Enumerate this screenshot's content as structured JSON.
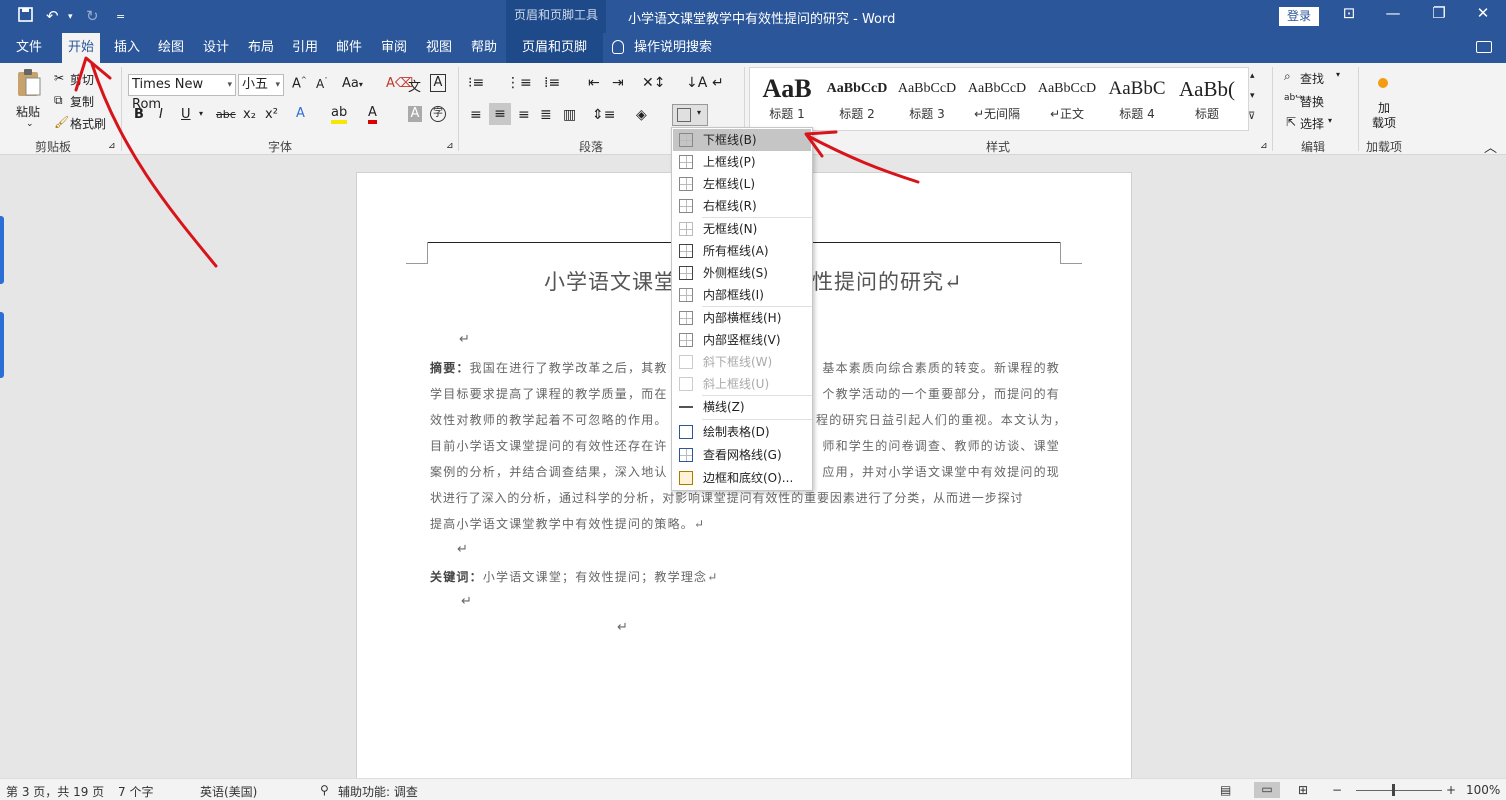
{
  "titlebar": {
    "context_tools": "页眉和页脚工具",
    "doc_title": "小学语文课堂教学中有效性提问的研究 - Word",
    "login": "登录",
    "quick_access_more": "="
  },
  "tabs": [
    {
      "label": "文件"
    },
    {
      "label": "开始"
    },
    {
      "label": "插入"
    },
    {
      "label": "绘图"
    },
    {
      "label": "设计"
    },
    {
      "label": "布局"
    },
    {
      "label": "引用"
    },
    {
      "label": "邮件"
    },
    {
      "label": "审阅"
    },
    {
      "label": "视图"
    },
    {
      "label": "帮助"
    },
    {
      "label": "页眉和页脚"
    }
  ],
  "tell_me": "操作说明搜索",
  "clipboard": {
    "paste": "粘贴",
    "cut": "剪切",
    "copy": "复制",
    "format_painter": "格式刷",
    "group": "剪贴板"
  },
  "font": {
    "name": "Times New Rom",
    "size": "小五",
    "group": "字体",
    "case": "Aa",
    "bold": "B",
    "italic": "I",
    "underline": "U",
    "strike": "abc",
    "subscript": "x₂",
    "superscript": "x²",
    "font_color": "A",
    "char_shading": "A"
  },
  "paragraph": {
    "group": "段落"
  },
  "styles": {
    "group": "样式",
    "items": [
      {
        "sample": "AaB",
        "name": "标题 1"
      },
      {
        "sample": "AaBbCcD",
        "name": "标题 2"
      },
      {
        "sample": "AaBbCcD",
        "name": "标题 3"
      },
      {
        "sample": "AaBbCcD",
        "name": "↵无间隔"
      },
      {
        "sample": "AaBbCcD",
        "name": "↵正文"
      },
      {
        "sample": "AaBbC",
        "name": "标题 4"
      },
      {
        "sample": "AaBb(",
        "name": "标题"
      }
    ]
  },
  "editing": {
    "find": "查找",
    "replace": "替换",
    "select": "选择",
    "group": "编辑"
  },
  "addins": {
    "label": "加\n载项",
    "group": "加载项"
  },
  "border_menu": {
    "items": [
      {
        "label": "下框线(B)",
        "state": "highlighted"
      },
      {
        "label": "上框线(P)"
      },
      {
        "label": "左框线(L)"
      },
      {
        "label": "右框线(R)"
      },
      {
        "label": "无框线(N)"
      },
      {
        "label": "所有框线(A)"
      },
      {
        "label": "外侧框线(S)"
      },
      {
        "label": "内部框线(I)"
      },
      {
        "label": "内部横框线(H)"
      },
      {
        "label": "内部竖框线(V)"
      },
      {
        "label": "斜下框线(W)",
        "state": "disabled"
      },
      {
        "label": "斜上框线(U)",
        "state": "disabled"
      },
      {
        "label": "横线(Z)"
      },
      {
        "label": "绘制表格(D)"
      },
      {
        "label": "查看网格线(G)"
      },
      {
        "label": "边框和底纹(O)..."
      }
    ]
  },
  "document": {
    "heading_left": "小学语文课堂",
    "heading_right": "性提问的研究↵",
    "abstract_label": "摘要：",
    "abstract_lines": [
      "我国在进行了教学改革之后，其教",
      "学目标要求提高了课程的教学质量，而在",
      "效性对教师的教学起着不可忽略的作用。",
      "目前小学语文课堂提问的有效性还存在许",
      "案例的分析，并结合调查结果，深入地认",
      "状进行了深入的分析，通过科学的分析，对影响课堂提问有效性的重要因素进行了分类，从而进一步探讨",
      "提高小学语文课堂教学中有效性提问的策略。↵"
    ],
    "abstract_right": [
      "基本素质向综合素质的转变。新课程的教",
      "个教学活动的一个重要部分，而提问的有",
      "程的研究日益引起人们的重视。本文认为，",
      "师和学生的问卷调查、教师的访谈、课堂",
      "应用，并对小学语文课堂中有效提问的现"
    ],
    "keywords_label": "关键词：",
    "keywords": "小学语文课堂；有效性提问；教学理念↵",
    "pilcrow": "↵"
  },
  "status": {
    "page": "第 3 页，共 19 页",
    "words": "7 个字",
    "language": "英语(美国)",
    "accessibility": "辅助功能: 调查",
    "zoom": "100%",
    "zoom_minus": "−",
    "zoom_plus": "+"
  },
  "colors": {
    "brand": "#2b579a",
    "annotation": "#d8141b"
  }
}
